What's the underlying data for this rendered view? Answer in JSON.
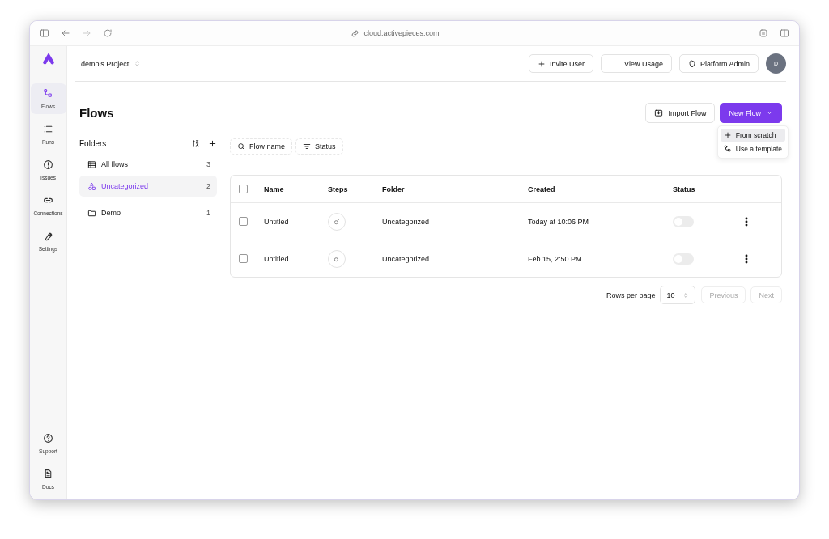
{
  "browser": {
    "url": "cloud.activepieces.com"
  },
  "sidebar": {
    "items": [
      {
        "label": "Flows",
        "selected": true
      },
      {
        "label": "Runs",
        "selected": false
      },
      {
        "label": "Issues",
        "selected": false
      },
      {
        "label": "Connections",
        "selected": false
      },
      {
        "label": "Settings",
        "selected": false
      }
    ],
    "bottom_items": [
      {
        "label": "Support"
      },
      {
        "label": "Docs"
      }
    ]
  },
  "header": {
    "project": "demo's Project",
    "buttons": [
      "Invite User",
      "View Usage",
      "Platform Admin"
    ],
    "avatar": "D"
  },
  "page": {
    "title": "Flows",
    "actions": [
      {
        "label": "Import Flow",
        "kind": "secondary"
      },
      {
        "label": "New Flow",
        "kind": "primary"
      }
    ],
    "menu": [
      {
        "label": "From scratch",
        "selected": true
      },
      {
        "label": "Use a template",
        "selected": false
      }
    ]
  },
  "folders": {
    "title": "Folders",
    "items": [
      {
        "label": "All flows",
        "count": "3",
        "selected": false
      },
      {
        "label": "Uncategorized",
        "count": "2",
        "selected": true
      },
      {
        "label": "Demo",
        "count": "1",
        "selected": false
      }
    ]
  },
  "filters": [
    "Flow name",
    "Status"
  ],
  "table": {
    "columns": [
      "Name",
      "Steps",
      "Folder",
      "Created",
      "Status"
    ],
    "all_checked": false,
    "rows": [
      {
        "checked": false,
        "name": "Untitled",
        "folder": "Uncategorized",
        "created": "Today at 10:06 PM",
        "enabled": false
      },
      {
        "checked": false,
        "name": "Untitled",
        "folder": "Uncategorized",
        "created": "Feb 15, 2:50 PM",
        "enabled": false
      }
    ]
  },
  "pagination": {
    "label": "Rows per page",
    "page_size": "10",
    "previous": {
      "label": "Previous",
      "disabled": true
    },
    "next": {
      "label": "Next",
      "disabled": true
    }
  }
}
